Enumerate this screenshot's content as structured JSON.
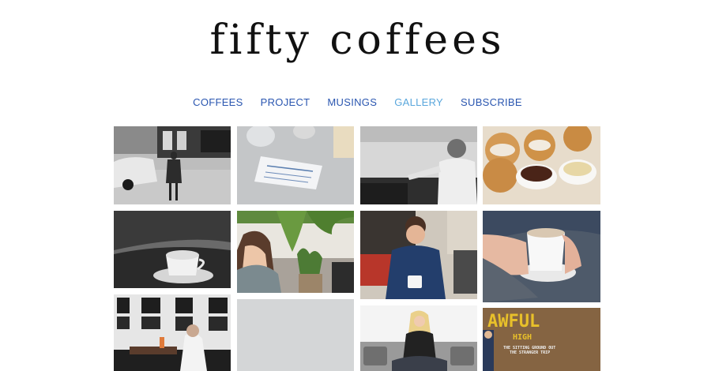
{
  "site": {
    "logo": "fifty coffees"
  },
  "nav": {
    "items": [
      {
        "label": "COFFEES"
      },
      {
        "label": "PROJECT"
      },
      {
        "label": "MUSINGS"
      },
      {
        "label": "GALLERY",
        "active": true
      },
      {
        "label": "SUBSCRIBE"
      }
    ]
  },
  "colors": {
    "nav_link": "#2a56b0",
    "nav_active": "#5aa7dc",
    "logo": "#111111"
  },
  "gallery": {
    "photos": [
      {
        "name": "photo-woman-street-taxi"
      },
      {
        "name": "photo-receipt-on-table"
      },
      {
        "name": "photo-man-seated-bw"
      },
      {
        "name": "photo-donuts-and-dips"
      },
      {
        "name": "photo-coffee-cup-bw"
      },
      {
        "name": "photo-woman-plants"
      },
      {
        "name": "photo-man-blue-sweater"
      },
      {
        "name": "photo-hands-white-mug"
      },
      {
        "name": "photo-man-framed-wall"
      },
      {
        "name": "photo-grey-wall"
      },
      {
        "name": "photo-woman-grey-sofa"
      },
      {
        "name": "photo-awful-sign"
      }
    ],
    "sign_title": "AWFUL",
    "sign_line2": "HIGH",
    "sign_sub1": "THE SITTING GROUND OUT",
    "sign_sub2": "THE STRANGER TRIP"
  }
}
